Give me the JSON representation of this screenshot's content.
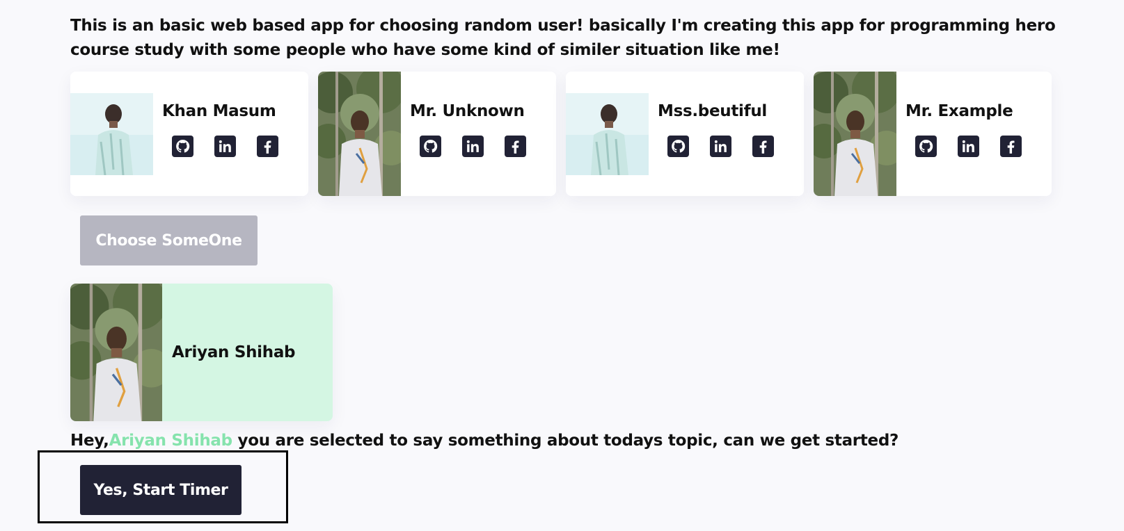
{
  "intro": {
    "text": "This is an basic web based app for choosing random user! basically I'm creating this app for programming hero course study with some people who have some kind of similer situation like me!"
  },
  "users": [
    {
      "name": "Khan Masum",
      "photo_style": "light"
    },
    {
      "name": "Mr. Unknown",
      "photo_style": "forest"
    },
    {
      "name": "Mss.beutiful",
      "photo_style": "light"
    },
    {
      "name": "Mr. Example",
      "photo_style": "forest"
    }
  ],
  "social_icons": [
    "github-icon",
    "linkedin-icon",
    "facebook-icon"
  ],
  "choose_button": {
    "label": "Choose SomeOne",
    "state": "disabled"
  },
  "selected": {
    "name": "Ariyan Shihab"
  },
  "message": {
    "prefix": "Hey,",
    "name": "Ariyan Shihab",
    "suffix": " you are selected to say something about todays topic, can we get started?"
  },
  "start_button": {
    "label": "Yes, Start Timer"
  },
  "colors": {
    "page_bg": "#f9f9fc",
    "dark_accent": "#212235",
    "disabled_button": "#b6b6c1",
    "selected_card_bg": "#d4f6e3",
    "name_highlight": "#86e3ad"
  }
}
